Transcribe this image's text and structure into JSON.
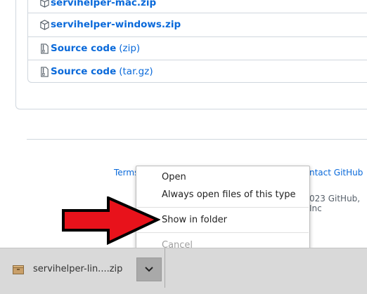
{
  "assets": [
    {
      "name": "servihelper-mac.zip",
      "ext": "",
      "icon": "package-icon"
    },
    {
      "name": "servihelper-windows.zip",
      "ext": "",
      "icon": "package-icon"
    },
    {
      "name": "Source code",
      "ext": "(zip)",
      "icon": "file-zip-icon"
    },
    {
      "name": "Source code",
      "ext": "(tar.gz)",
      "icon": "file-zip-icon"
    }
  ],
  "footer": {
    "terms": "Terms",
    "contact": "ntact GitHub",
    "copyright": "023 GitHub, Inc"
  },
  "context_menu": {
    "open": "Open",
    "always_open": "Always open files of this type",
    "show_in_folder": "Show in folder",
    "cancel": "Cancel"
  },
  "download_shelf": {
    "filename": "servihelper-lin....zip"
  },
  "colors": {
    "link": "#0969da",
    "arrow_fill": "#e8121b",
    "arrow_stroke": "#000000"
  }
}
